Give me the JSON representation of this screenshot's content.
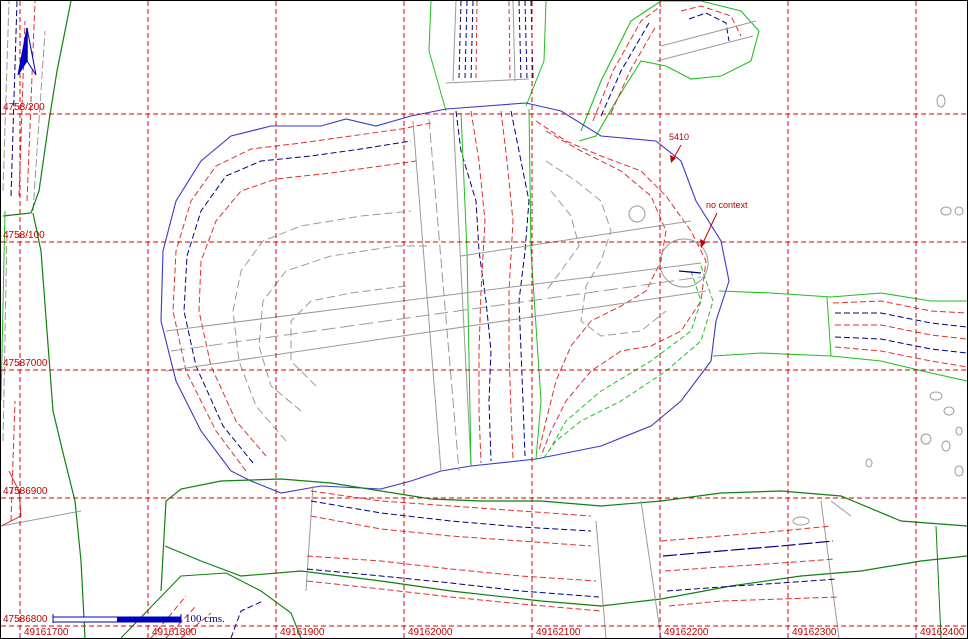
{
  "map": {
    "colors": {
      "grid": "#e00000",
      "contour_red": "#e03030",
      "contour_blue": "#000080",
      "contour_gray": "#9a9a9a",
      "boundary_blue": "#3a3ac8",
      "green_light": "#20c020",
      "green_dark": "#108010",
      "annotation": "#c00000",
      "north_arrow": "#0000c0"
    },
    "grid_labels": {
      "y": [
        "4758/200",
        "4758/100",
        "47587000",
        "47586900",
        "47586800"
      ],
      "x": [
        "49161700",
        "49161800",
        "49161900",
        "49162000",
        "49162100",
        "49162200",
        "49162300",
        "49162400"
      ]
    },
    "annotations": {
      "elevation": "5410",
      "context": "no context"
    },
    "scale_bar": {
      "label": "100 cms."
    },
    "icons": {
      "north_arrow": "north-arrow-icon"
    }
  }
}
